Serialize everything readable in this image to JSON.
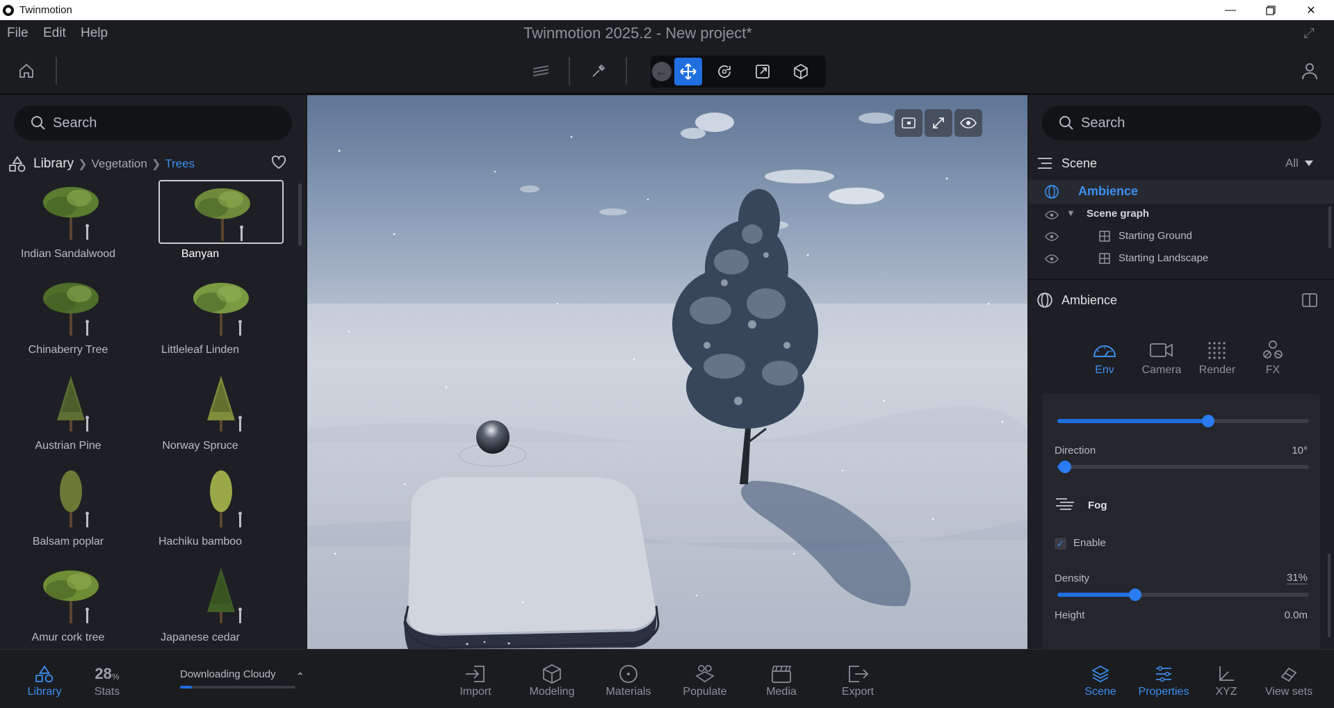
{
  "window": {
    "app_name": "Twinmotion"
  },
  "menubar": {
    "file": "File",
    "edit": "Edit",
    "help": "Help",
    "title": "Twinmotion 2025.2 - New project*"
  },
  "left_panel": {
    "search_placeholder": "Search",
    "breadcrumb": {
      "root": "Library",
      "level1": "Vegetation",
      "level2": "Trees"
    },
    "items": [
      {
        "label": "Indian Sandalwood",
        "selected": false
      },
      {
        "label": "Banyan",
        "selected": true
      },
      {
        "label": "Chinaberry Tree",
        "selected": false
      },
      {
        "label": "Littleleaf Linden",
        "selected": false
      },
      {
        "label": "Austrian Pine",
        "selected": false
      },
      {
        "label": "Norway Spruce",
        "selected": false
      },
      {
        "label": "Balsam poplar",
        "selected": false
      },
      {
        "label": "Hachiku bamboo",
        "selected": false
      },
      {
        "label": "Amur cork tree",
        "selected": false
      },
      {
        "label": "Japanese cedar",
        "selected": false
      }
    ]
  },
  "right_panel": {
    "search_placeholder": "Search",
    "scene_title": "Scene",
    "scene_filter": "All",
    "tree": {
      "ambience": "Ambience",
      "scene_graph": "Scene graph",
      "starting_ground": "Starting Ground",
      "starting_landscape": "Starting Landscape"
    },
    "properties_title": "Ambience",
    "tabs": {
      "env": "Env",
      "camera": "Camera",
      "render": "Render",
      "fx": "FX"
    },
    "wind_slider_fraction": 0.6,
    "direction": {
      "label": "Direction",
      "value": "10°",
      "fraction": 0.03
    },
    "fog": {
      "title": "Fog",
      "enable_label": "Enable",
      "enabled": true,
      "density": {
        "label": "Density",
        "value": "31%",
        "fraction": 0.31
      },
      "height": {
        "label": "Height",
        "value": "0.0m"
      }
    }
  },
  "bottom_bar": {
    "library": "Library",
    "stats_value": "28",
    "stats_unit": "%",
    "stats_label": "Stats",
    "download_text": "Downloading Cloudy",
    "download_fraction": 0.1,
    "import": "Import",
    "modeling": "Modeling",
    "materials": "Materials",
    "populate": "Populate",
    "media": "Media",
    "export": "Export",
    "scene": "Scene",
    "properties": "Properties",
    "xyz": "XYZ",
    "view_sets": "View sets"
  },
  "colors": {
    "accent": "#1f6fe0",
    "accent_text": "#3c8ff0",
    "panel": "#1e1f24"
  }
}
